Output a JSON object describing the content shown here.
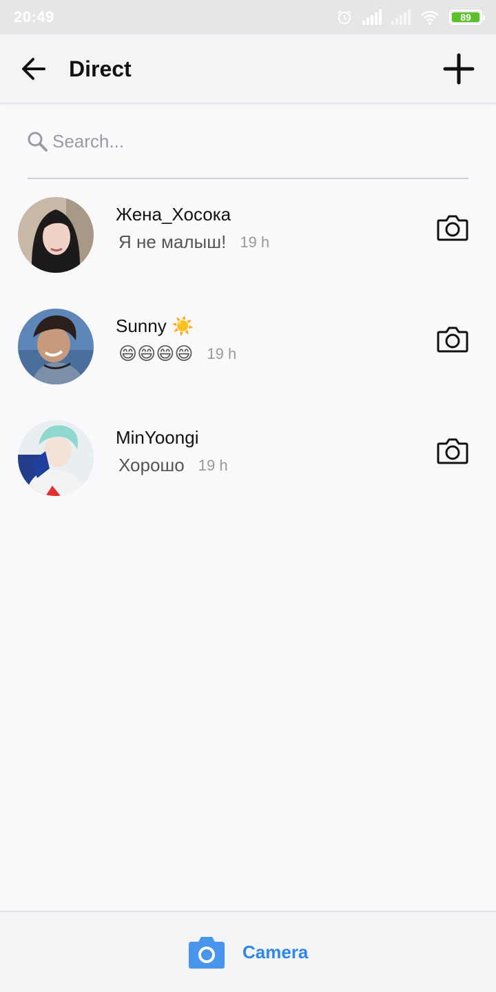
{
  "status_bar": {
    "time": "20:49",
    "battery": "89"
  },
  "header": {
    "title": "Direct"
  },
  "search": {
    "placeholder": "Search..."
  },
  "conversations": [
    {
      "name": "Жена_Хосока",
      "preview": "Я не малыш!",
      "time": "19 h"
    },
    {
      "name": "Sunny ☀️",
      "preview": "😄😄😄😄",
      "time": "19 h"
    },
    {
      "name": "MinYoongi",
      "preview": "Хорошо",
      "time": "19 h"
    }
  ],
  "bottom": {
    "camera_label": "Camera"
  },
  "colors": {
    "accent": "#2d88e8",
    "battery": "#5cc02a"
  }
}
